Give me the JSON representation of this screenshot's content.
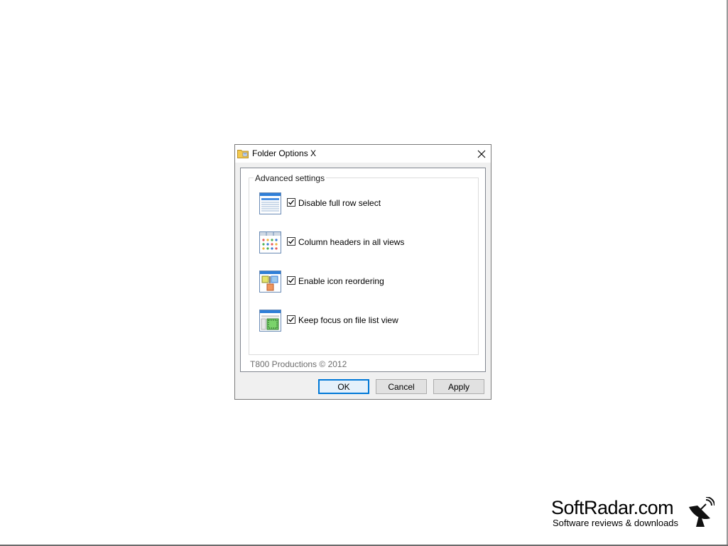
{
  "window": {
    "title": "Folder Options X",
    "close_label": "×"
  },
  "group": {
    "title": "Advanced settings"
  },
  "options": [
    {
      "label": "Disable full row select",
      "checked": true,
      "icon": "full-row-select-icon"
    },
    {
      "label": "Column headers in all views",
      "checked": true,
      "icon": "column-headers-icon"
    },
    {
      "label": "Enable icon reordering",
      "checked": true,
      "icon": "icon-reordering-icon"
    },
    {
      "label": "Keep focus on file list view",
      "checked": true,
      "icon": "focus-list-view-icon"
    }
  ],
  "footer": {
    "copyright": "T800 Productions © 2012"
  },
  "buttons": {
    "ok": "OK",
    "cancel": "Cancel",
    "apply": "Apply"
  },
  "watermark": {
    "title": "SoftRadar.com",
    "subtitle": "Software reviews & downloads"
  },
  "colors": {
    "accent": "#0078d7",
    "dialog_bg": "#f0f0f0"
  }
}
